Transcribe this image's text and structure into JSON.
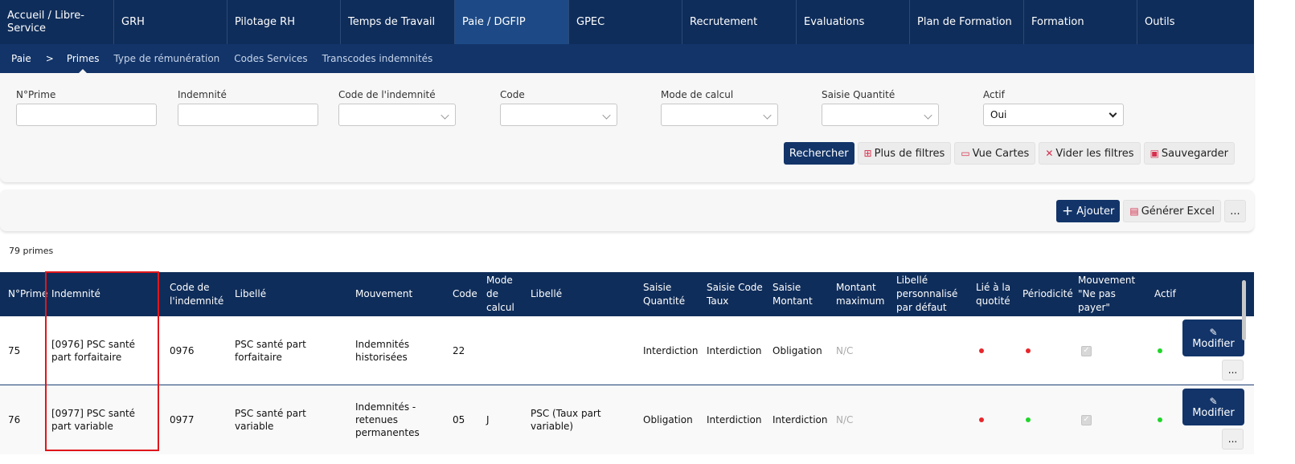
{
  "topnav": [
    {
      "label": "Accueil / Libre-Service",
      "active": false
    },
    {
      "label": "GRH",
      "active": false
    },
    {
      "label": "Pilotage RH",
      "active": false
    },
    {
      "label": "Temps de Travail",
      "active": false
    },
    {
      "label": "Paie / DGFIP",
      "active": true
    },
    {
      "label": "GPEC",
      "active": false
    },
    {
      "label": "Recrutement",
      "active": false
    },
    {
      "label": "Evaluations",
      "active": false
    },
    {
      "label": "Plan de Formation",
      "active": false
    },
    {
      "label": "Formation",
      "active": false
    },
    {
      "label": "Outils",
      "active": false
    }
  ],
  "subnav": {
    "crumb": "Paie",
    "separator": ">",
    "current": "Primes",
    "tabs": [
      "Type de rémunération",
      "Codes Services",
      "Transcodes indemnités"
    ]
  },
  "filters": {
    "num_prime": {
      "label": "N°Prime",
      "value": ""
    },
    "indemnite": {
      "label": "Indemnité",
      "value": ""
    },
    "code_indemnite": {
      "label": "Code de l'indemnité",
      "value": ""
    },
    "code": {
      "label": "Code",
      "value": ""
    },
    "mode_calcul": {
      "label": "Mode de calcul",
      "value": ""
    },
    "saisie_quantite": {
      "label": "Saisie Quantité",
      "value": ""
    },
    "actif": {
      "label": "Actif",
      "value": "Oui"
    }
  },
  "filter_buttons": {
    "search": "Rechercher",
    "more_filters": "Plus de filtres",
    "card_view": "Vue Cartes",
    "clear": "Vider les filtres",
    "save": "Sauvegarder"
  },
  "actions": {
    "add": "Ajouter",
    "excel": "Générer Excel",
    "more": "..."
  },
  "count": "79 primes",
  "table": {
    "headers": {
      "num": "N°Prime",
      "indemnite": "Indemnité",
      "code_indemnite": "Code de l'indemnité",
      "libelle": "Libellé",
      "mouvement": "Mouvement",
      "code": "Code",
      "mode_calcul": "Mode de calcul",
      "libelle2": "Libellé",
      "saisie_quantite": "Saisie Quantité",
      "saisie_code_taux": "Saisie Code Taux",
      "saisie_montant": "Saisie Montant",
      "montant_max": "Montant maximum",
      "libelle_perso": "Libellé personnalisé par défaut",
      "lie_quotite": "Lié à la quotité",
      "periodicite": "Périodicité",
      "mouvement_npp": "Mouvement \"Ne pas payer\"",
      "actif": "Actif"
    },
    "rows": [
      {
        "num": "75",
        "indemnite": "[0976] PSC santé part forfaitaire",
        "code_indemnite": "0976",
        "libelle": "PSC santé part forfaitaire",
        "mouvement": "Indemnités historisées",
        "code": "22",
        "mode_calcul": "",
        "libelle2": "",
        "saisie_quantite": "Interdiction",
        "saisie_code_taux": "Interdiction",
        "saisie_montant": "Obligation",
        "montant_max": "N/C",
        "libelle_perso": "",
        "lie_quotite": "red",
        "periodicite": "red",
        "mouvement_npp": true,
        "actif": "green",
        "modify": "Modifier",
        "more": "..."
      },
      {
        "num": "76",
        "indemnite": "[0977] PSC santé part variable",
        "code_indemnite": "0977",
        "libelle": "PSC santé part variable",
        "mouvement": "Indemnités - retenues permanentes",
        "code": "05",
        "mode_calcul": "J",
        "libelle2": "PSC (Taux part variable)",
        "saisie_quantite": "Obligation",
        "saisie_code_taux": "Interdiction",
        "saisie_montant": "Interdiction",
        "montant_max": "N/C",
        "libelle_perso": "",
        "lie_quotite": "red",
        "periodicite": "green",
        "mouvement_npp": true,
        "actif": "green",
        "modify": "Modifier",
        "more": "..."
      }
    ]
  },
  "colors": {
    "nav": "#0f2d5a",
    "nav_active": "#1d4a86",
    "accent": "#123469",
    "highlight": "#e0161c",
    "status_red": "#e8262b",
    "status_green": "#20d62a"
  }
}
